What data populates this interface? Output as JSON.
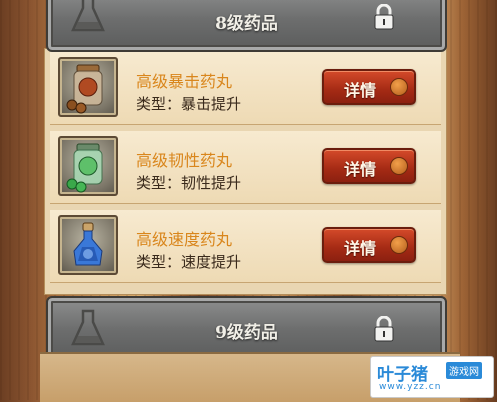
{
  "header": {
    "title": "8级药品",
    "lock_icon": "lock-icon",
    "flask_icon": "flask-icon"
  },
  "items": [
    {
      "name": "高级暴击药丸",
      "type": "类型：暴击提升",
      "button": "详情",
      "icon": "brown-pill-jar-icon",
      "pill_color": "#8a4f1f"
    },
    {
      "name": "高级韧性药丸",
      "type": "类型：韧性提升",
      "button": "详情",
      "icon": "green-pill-jar-icon",
      "pill_color": "#3aa84a"
    },
    {
      "name": "高级速度药丸",
      "type": "类型：速度提升",
      "button": "详情",
      "icon": "blue-potion-bottle-icon",
      "pill_color": "#2f6fd0"
    }
  ],
  "footer_plate": {
    "title": "9级药品",
    "lock_icon": "lock-icon",
    "flask_icon": "flask-icon"
  },
  "watermark": {
    "brand": "叶子猪",
    "tag": "游戏网",
    "url": "www.yzz.cn"
  },
  "colors": {
    "name_text": "#d9861c",
    "button": "#a42a14",
    "plate": "#6d6e6e"
  }
}
